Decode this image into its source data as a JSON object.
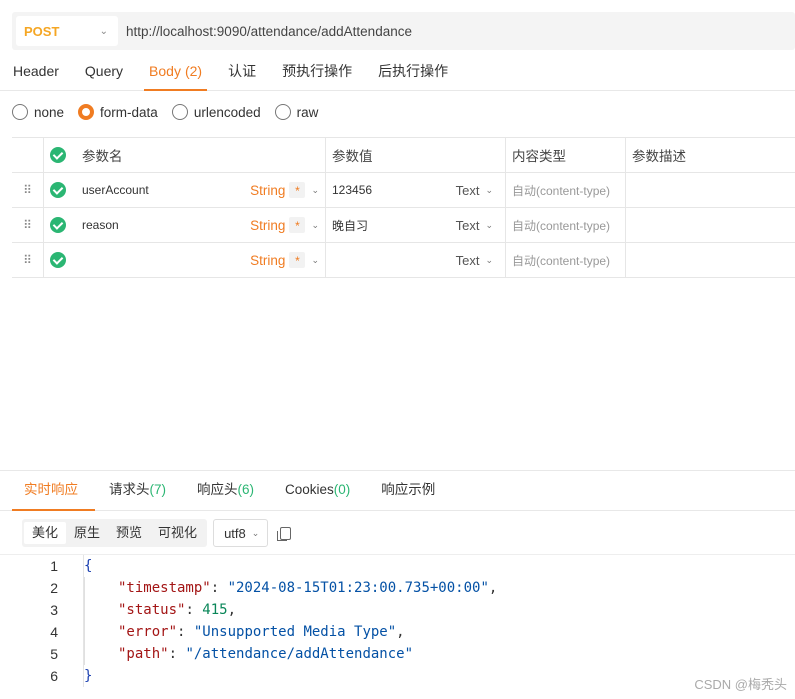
{
  "request": {
    "method": "POST",
    "url": "http://localhost:9090/attendance/addAttendance"
  },
  "req_tabs": [
    {
      "label": "Header",
      "count": ""
    },
    {
      "label": "Query",
      "count": ""
    },
    {
      "label": "Body",
      "count": "(2)"
    },
    {
      "label": "认证",
      "count": ""
    },
    {
      "label": "预执行操作",
      "count": ""
    },
    {
      "label": "后执行操作",
      "count": ""
    }
  ],
  "body_types": [
    "none",
    "form-data",
    "urlencoded",
    "raw"
  ],
  "selected_body_type": "form-data",
  "table": {
    "headers": {
      "name": "参数名",
      "value": "参数值",
      "content_type": "内容类型",
      "desc": "参数描述"
    },
    "rows": [
      {
        "name": "userAccount",
        "type": "String",
        "required": "*",
        "value": "123456",
        "value_type": "Text",
        "content_type": "自动(content-type)",
        "desc": ""
      },
      {
        "name": "reason",
        "type": "String",
        "required": "*",
        "value": "晚自习",
        "value_type": "Text",
        "content_type": "自动(content-type)",
        "desc": ""
      },
      {
        "name": "",
        "type": "String",
        "required": "*",
        "value": "",
        "value_type": "Text",
        "content_type": "自动(content-type)",
        "desc": ""
      }
    ]
  },
  "resp_tabs": [
    {
      "label": "实时响应",
      "count": ""
    },
    {
      "label": "请求头",
      "count": "(7)"
    },
    {
      "label": "响应头",
      "count": "(6)"
    },
    {
      "label": "Cookies",
      "count": "(0)"
    },
    {
      "label": "响应示例",
      "count": ""
    }
  ],
  "view_modes": [
    "美化",
    "原生",
    "预览",
    "可视化"
  ],
  "encoding": "utf8",
  "response_json": {
    "timestamp_key": "\"timestamp\"",
    "timestamp_val": "\"2024-08-15T01:23:00.735+00:00\"",
    "status_key": "\"status\"",
    "status_val": "415",
    "error_key": "\"error\"",
    "error_val": "\"Unsupported Media Type\"",
    "path_key": "\"path\"",
    "path_val": "\"/attendance/addAttendance\""
  },
  "line_numbers": [
    "1",
    "2",
    "3",
    "4",
    "5",
    "6"
  ],
  "watermark": "CSDN @梅秃头",
  "colors": {
    "accent": "#f07c22",
    "success": "#2bb673",
    "method": "#f5a623"
  }
}
